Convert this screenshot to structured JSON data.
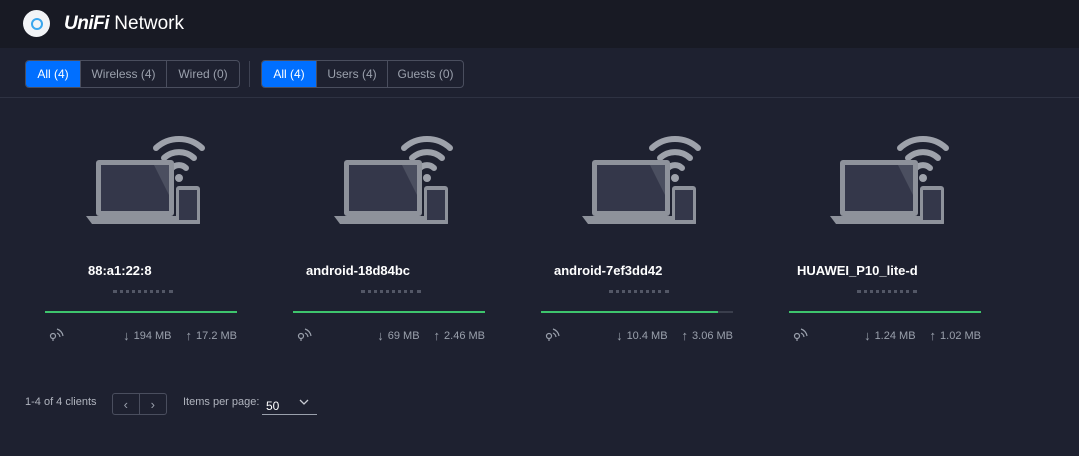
{
  "header": {
    "brand_uni": "UniFi",
    "brand_rest": " Network"
  },
  "filters": {
    "connection": [
      {
        "label": "All (4)",
        "active": true
      },
      {
        "label": "Wireless (4)",
        "active": false
      },
      {
        "label": "Wired (0)",
        "active": false
      }
    ],
    "client_type": [
      {
        "label": "All (4)",
        "active": true
      },
      {
        "label": "Users (4)",
        "active": false
      },
      {
        "label": "Guests (0)",
        "active": false
      }
    ]
  },
  "clients": [
    {
      "name": "88:a1:22:8",
      "download": "194 MB",
      "upload": "17.2 MB",
      "signal_fraction": 1.0
    },
    {
      "name": "android-18d84bc",
      "download": "69 MB",
      "upload": "2.46 MB",
      "signal_fraction": 1.0
    },
    {
      "name": "android-7ef3dd42",
      "download": "10.4 MB",
      "upload": "3.06 MB",
      "signal_fraction": 0.92
    },
    {
      "name": "HUAWEI_P10_lite-d",
      "download": "1.24 MB",
      "upload": "1.02 MB",
      "signal_fraction": 1.0
    }
  ],
  "footer": {
    "count": "1-4 of 4 clients",
    "items_per_page_label": "Items per page:",
    "items_per_page_value": "50"
  },
  "colors": {
    "accent": "#006fff",
    "signal_bar": "#3ec46d",
    "background": "#1e2130"
  },
  "icons": {
    "logo": "unifi-logo-icon",
    "device": "laptop-phone-wifi-icon",
    "signal": "wireless-signal-icon",
    "download": "arrow-down-icon",
    "upload": "arrow-up-icon",
    "prev": "chevron-left-icon",
    "next": "chevron-right-icon",
    "dropdown": "chevron-down-icon"
  }
}
